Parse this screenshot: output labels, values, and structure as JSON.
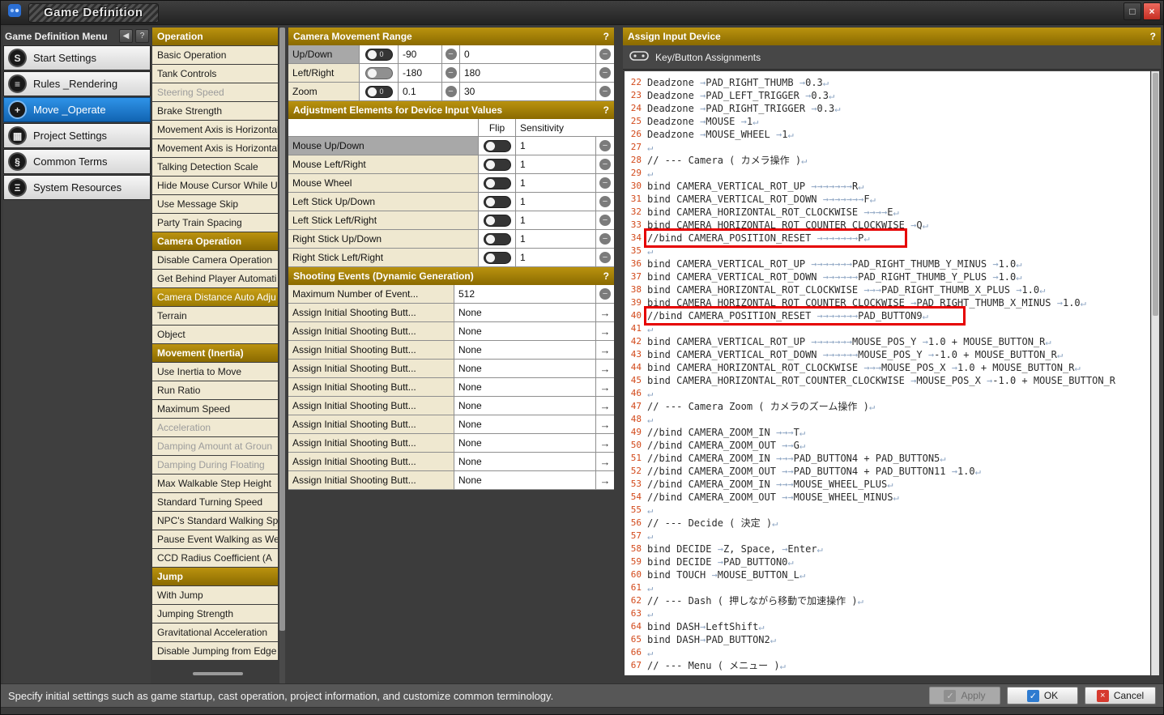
{
  "window": {
    "title": "Game Definition"
  },
  "icons": {
    "help": "?",
    "back": "◀",
    "minus": "−",
    "arrow": "→",
    "minimize": "□",
    "close": "×",
    "check": "✓",
    "cross": "×",
    "toggle_zero": "0"
  },
  "sidebar": {
    "header": "Game Definition Menu",
    "items": [
      {
        "label": "Start Settings",
        "icon": "S",
        "cls": ""
      },
      {
        "label": "Rules _Rendering",
        "icon": "≡",
        "cls": ""
      },
      {
        "label": "Move _Operate",
        "icon": "+",
        "cls": "selected"
      },
      {
        "label": "Project Settings",
        "icon": "▦",
        "cls": ""
      },
      {
        "label": "Common Terms",
        "icon": "§",
        "cls": ""
      },
      {
        "label": "System Resources",
        "icon": "Ξ",
        "cls": ""
      }
    ]
  },
  "operation_list": {
    "items": [
      {
        "label": "Operation",
        "cls": "header"
      },
      {
        "label": "Basic Operation",
        "cls": ""
      },
      {
        "label": "Tank Controls",
        "cls": ""
      },
      {
        "label": "Steering Speed",
        "cls": "disabled"
      },
      {
        "label": "Brake Strength",
        "cls": ""
      },
      {
        "label": "Movement Axis is Horizontal",
        "cls": ""
      },
      {
        "label": "Movement Axis is Horizontal",
        "cls": ""
      },
      {
        "label": "Talking Detection Scale",
        "cls": ""
      },
      {
        "label": "Hide Mouse Cursor While U",
        "cls": ""
      },
      {
        "label": "Use Message Skip",
        "cls": ""
      },
      {
        "label": "Party Train Spacing",
        "cls": ""
      },
      {
        "label": "Camera Operation",
        "cls": "header"
      },
      {
        "label": "Disable Camera Operation",
        "cls": ""
      },
      {
        "label": "Get Behind Player Automati",
        "cls": ""
      },
      {
        "label": "Camera Distance Auto Adju",
        "cls": "selected"
      },
      {
        "label": "Terrain",
        "cls": ""
      },
      {
        "label": "Object",
        "cls": ""
      },
      {
        "label": "Movement (Inertia)",
        "cls": "header"
      },
      {
        "label": "Use Inertia to Move",
        "cls": ""
      },
      {
        "label": "Run Ratio",
        "cls": ""
      },
      {
        "label": "Maximum Speed",
        "cls": ""
      },
      {
        "label": "Acceleration",
        "cls": "disabled"
      },
      {
        "label": "Damping Amount at Groun",
        "cls": "disabled"
      },
      {
        "label": "Damping During Floating",
        "cls": "disabled"
      },
      {
        "label": "Max Walkable Step Height",
        "cls": ""
      },
      {
        "label": "Standard Turning Speed",
        "cls": ""
      },
      {
        "label": "NPC's Standard Walking Sp",
        "cls": ""
      },
      {
        "label": "Pause Event Walking as We",
        "cls": ""
      },
      {
        "label": "CCD Radius Coefficient (A",
        "cls": ""
      },
      {
        "label": "Jump",
        "cls": "header"
      },
      {
        "label": "With Jump",
        "cls": ""
      },
      {
        "label": "Jumping Strength",
        "cls": ""
      },
      {
        "label": "Gravitational Acceleration",
        "cls": ""
      },
      {
        "label": "Disable Jumping from Edge",
        "cls": ""
      }
    ]
  },
  "camera_range": {
    "title": "Camera Movement Range",
    "rows": [
      {
        "label": "Up/Down",
        "min": "-90",
        "max": "0",
        "lcls": "sel",
        "tcls": "cam0"
      },
      {
        "label": "Left/Right",
        "min": "-180",
        "max": "180",
        "lcls": "",
        "tcls": "light"
      },
      {
        "label": "Zoom",
        "min": "0.1",
        "max": "30",
        "lcls": "",
        "tcls": "cam0"
      }
    ]
  },
  "adjustment": {
    "title": "Adjustment Elements for Device Input Values",
    "flip_header": "Flip",
    "sensitivity_header": "Sensitivity",
    "rows": [
      {
        "label": "Mouse Up/Down",
        "value": "1",
        "lcls": "sel"
      },
      {
        "label": "Mouse Left/Right",
        "value": "1",
        "lcls": ""
      },
      {
        "label": "Mouse Wheel",
        "value": "1",
        "lcls": ""
      },
      {
        "label": "Left Stick Up/Down",
        "value": "1",
        "lcls": ""
      },
      {
        "label": "Left Stick Left/Right",
        "value": "1",
        "lcls": ""
      },
      {
        "label": "Right Stick Up/Down",
        "value": "1",
        "lcls": ""
      },
      {
        "label": "Right Stick Left/Right",
        "value": "1",
        "lcls": ""
      }
    ]
  },
  "shooting": {
    "title": "Shooting Events (Dynamic Generation)",
    "max_label": "Maximum Number of Event...",
    "max_value": "512",
    "rows": [
      {
        "label": "Assign Initial Shooting Butt...",
        "value": "None"
      },
      {
        "label": "Assign Initial Shooting Butt...",
        "value": "None"
      },
      {
        "label": "Assign Initial Shooting Butt...",
        "value": "None"
      },
      {
        "label": "Assign Initial Shooting Butt...",
        "value": "None"
      },
      {
        "label": "Assign Initial Shooting Butt...",
        "value": "None"
      },
      {
        "label": "Assign Initial Shooting Butt...",
        "value": "None"
      },
      {
        "label": "Assign Initial Shooting Butt...",
        "value": "None"
      },
      {
        "label": "Assign Initial Shooting Butt...",
        "value": "None"
      },
      {
        "label": "Assign Initial Shooting Butt...",
        "value": "None"
      },
      {
        "label": "Assign Initial Shooting Butt...",
        "value": "None"
      }
    ]
  },
  "input_device": {
    "title": "Assign Input Device",
    "subtitle": "Key/Button Assignments",
    "lines": [
      {
        "n": 22,
        "t": "Deadzone →PAD_RIGHT_THUMB →0.3↵"
      },
      {
        "n": 23,
        "t": "Deadzone →PAD_LEFT_TRIGGER →0.3↵"
      },
      {
        "n": 24,
        "t": "Deadzone →PAD_RIGHT_TRIGGER →0.3↵"
      },
      {
        "n": 25,
        "t": "Deadzone →MOUSE →1↵"
      },
      {
        "n": 26,
        "t": "Deadzone →MOUSE_WHEEL →1↵"
      },
      {
        "n": 27,
        "t": "↵"
      },
      {
        "n": 28,
        "t": "// --- Camera ( カメラ操作 )↵"
      },
      {
        "n": 29,
        "t": "↵"
      },
      {
        "n": 30,
        "t": "bind CAMERA_VERTICAL_ROT_UP →→→→→→→R↵"
      },
      {
        "n": 31,
        "t": "bind CAMERA_VERTICAL_ROT_DOWN →→→→→→→F↵"
      },
      {
        "n": 32,
        "t": "bind CAMERA_HORIZONTAL_ROT_CLOCKWISE →→→→E↵"
      },
      {
        "n": 33,
        "t": "bind CAMERA_HORIZONTAL_ROT_COUNTER_CLOCKWISE →Q↵"
      },
      {
        "n": 34,
        "t": "//bind CAMERA_POSITION_RESET →→→→→→→P↵",
        "cls": "boxed"
      },
      {
        "n": 35,
        "t": "↵"
      },
      {
        "n": 36,
        "t": "bind CAMERA_VERTICAL_ROT_UP →→→→→→→PAD_RIGHT_THUMB_Y_MINUS →1.0↵"
      },
      {
        "n": 37,
        "t": "bind CAMERA_VERTICAL_ROT_DOWN →→→→→→PAD_RIGHT_THUMB_Y_PLUS →1.0↵"
      },
      {
        "n": 38,
        "t": "bind CAMERA_HORIZONTAL_ROT_CLOCKWISE →→→PAD_RIGHT_THUMB_X_PLUS →1.0↵"
      },
      {
        "n": 39,
        "t": "bind CAMERA_HORIZONTAL_ROT_COUNTER_CLOCKWISE →PAD_RIGHT_THUMB_X_MINUS →1.0↵"
      },
      {
        "n": 40,
        "t": "//bind CAMERA_POSITION_RESET →→→→→→→PAD_BUTTON9↵",
        "cls": "boxed"
      },
      {
        "n": 41,
        "t": "↵"
      },
      {
        "n": 42,
        "t": "bind CAMERA_VERTICAL_ROT_UP →→→→→→→MOUSE_POS_Y →1.0 + MOUSE_BUTTON_R↵"
      },
      {
        "n": 43,
        "t": "bind CAMERA_VERTICAL_ROT_DOWN →→→→→→MOUSE_POS_Y →-1.0 + MOUSE_BUTTON_R↵"
      },
      {
        "n": 44,
        "t": "bind CAMERA_HORIZONTAL_ROT_CLOCKWISE →→→MOUSE_POS_X →1.0 + MOUSE_BUTTON_R↵"
      },
      {
        "n": 45,
        "t": "bind CAMERA_HORIZONTAL_ROT_COUNTER_CLOCKWISE →MOUSE_POS_X →-1.0 + MOUSE_BUTTON_R"
      },
      {
        "n": 46,
        "t": "↵"
      },
      {
        "n": 47,
        "t": "// --- Camera Zoom ( カメラのズーム操作 )↵"
      },
      {
        "n": 48,
        "t": "↵"
      },
      {
        "n": 49,
        "t": "//bind CAMERA_ZOOM_IN →→→T↵"
      },
      {
        "n": 50,
        "t": "//bind CAMERA_ZOOM_OUT →→G↵"
      },
      {
        "n": 51,
        "t": "//bind CAMERA_ZOOM_IN →→→PAD_BUTTON4 + PAD_BUTTON5↵"
      },
      {
        "n": 52,
        "t": "//bind CAMERA_ZOOM_OUT →→PAD_BUTTON4 + PAD_BUTTON11 →1.0↵"
      },
      {
        "n": 53,
        "t": "//bind CAMERA_ZOOM_IN →→→MOUSE_WHEEL_PLUS↵"
      },
      {
        "n": 54,
        "t": "//bind CAMERA_ZOOM_OUT →→MOUSE_WHEEL_MINUS↵"
      },
      {
        "n": 55,
        "t": "↵"
      },
      {
        "n": 56,
        "t": "// --- Decide ( 決定 )↵"
      },
      {
        "n": 57,
        "t": "↵"
      },
      {
        "n": 58,
        "t": "bind DECIDE →Z, Space, →Enter↵"
      },
      {
        "n": 59,
        "t": "bind DECIDE →PAD_BUTTON0↵"
      },
      {
        "n": 60,
        "t": "bind TOUCH →MOUSE_BUTTON_L↵"
      },
      {
        "n": 61,
        "t": "↵"
      },
      {
        "n": 62,
        "t": "// --- Dash ( 押しながら移動で加速操作 )↵"
      },
      {
        "n": 63,
        "t": "↵"
      },
      {
        "n": 64,
        "t": "bind DASH→LeftShift↵"
      },
      {
        "n": 65,
        "t": "bind DASH→PAD_BUTTON2↵"
      },
      {
        "n": 66,
        "t": "↵"
      },
      {
        "n": 67,
        "t": "// --- Menu ( メニュー )↵"
      }
    ]
  },
  "footer": {
    "status": "Specify initial settings such as game startup, cast operation, project information, and customize common terminology.",
    "apply": "Apply",
    "ok": "OK",
    "cancel": "Cancel"
  }
}
